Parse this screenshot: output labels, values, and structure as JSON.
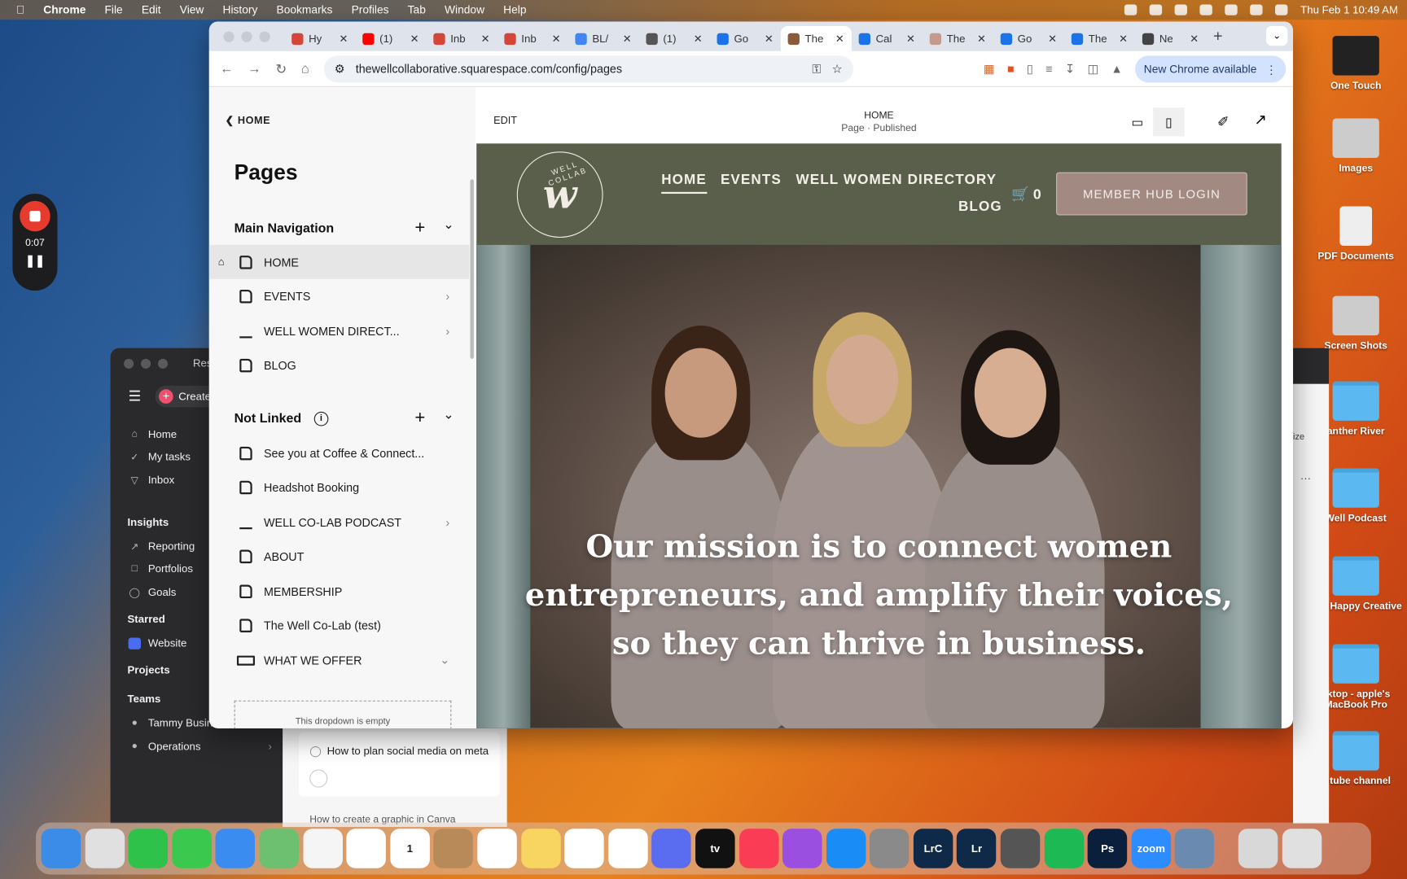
{
  "menubar": {
    "app": "Chrome",
    "items": [
      "File",
      "Edit",
      "View",
      "History",
      "Bookmarks",
      "Profiles",
      "Tab",
      "Window",
      "Help"
    ],
    "datetime": "Thu Feb 1  10:49 AM"
  },
  "recorder": {
    "time": "0:07"
  },
  "browser": {
    "tabs": [
      {
        "title": "Hy",
        "color": "#d44638"
      },
      {
        "title": "(1)",
        "color": "#ff0000"
      },
      {
        "title": "Inb",
        "color": "#d44638"
      },
      {
        "title": "Inb",
        "color": "#d44638"
      },
      {
        "title": "BL/",
        "color": "#4285f4"
      },
      {
        "title": "(1)",
        "color": "#555555"
      },
      {
        "title": "Go",
        "color": "#1a73e8"
      },
      {
        "title": "The",
        "color": "#8a5a3a",
        "active": true
      },
      {
        "title": "Cal",
        "color": "#1a73e8"
      },
      {
        "title": "The",
        "color": "#c49a8a"
      },
      {
        "title": "Go",
        "color": "#1a73e8"
      },
      {
        "title": "The",
        "color": "#1a73e8"
      },
      {
        "title": "Ne",
        "color": "#444444"
      }
    ],
    "url": "thewellcollaborative.squarespace.com/config/pages",
    "update_label": "New Chrome available"
  },
  "pages_panel": {
    "back_label": "HOME",
    "title": "Pages",
    "main_nav_label": "Main Navigation",
    "main_nav": [
      {
        "label": "HOME",
        "icon": "page",
        "home": true,
        "selected": true
      },
      {
        "label": "EVENTS",
        "icon": "calendar",
        "chevron": true
      },
      {
        "label": "WELL WOMEN DIRECT...",
        "icon": "edit",
        "chevron": true
      },
      {
        "label": "BLOG",
        "icon": "page"
      }
    ],
    "not_linked_label": "Not Linked",
    "not_linked": [
      {
        "label": "See you at Coffee & Connect...",
        "icon": "page"
      },
      {
        "label": "Headshot Booking",
        "icon": "page"
      },
      {
        "label": "WELL CO-LAB PODCAST",
        "icon": "edit",
        "chevron": true
      },
      {
        "label": "ABOUT",
        "icon": "page"
      },
      {
        "label": "MEMBERSHIP",
        "icon": "page"
      },
      {
        "label": "The Well Co-Lab (test)",
        "icon": "page"
      },
      {
        "label": "WHAT WE OFFER",
        "icon": "dropdown",
        "expand": true
      }
    ],
    "empty_dropdown": "This dropdown is empty"
  },
  "preview": {
    "edit_label": "EDIT",
    "page_title": "HOME",
    "page_status": "Page · Published",
    "site": {
      "logo_text": "WELL COLLAB",
      "logo_letter": "w",
      "nav": [
        "HOME",
        "EVENTS",
        "WELL WOMEN DIRECTORY",
        "BLOG"
      ],
      "cart_count": "0",
      "login_label": "MEMBER HUB LOGIN",
      "mission": "Our mission is to connect women entrepreneurs, and amplify their voices, so they can thrive in business.",
      "header_color": "#5a5f4c",
      "button_color": "#a28a82"
    }
  },
  "asana": {
    "title": "Res",
    "create": "Create",
    "items": [
      "Home",
      "My tasks",
      "Inbox"
    ],
    "insights": "Insights",
    "insight_items": [
      "Reporting",
      "Portfolios",
      "Goals"
    ],
    "starred": "Starred",
    "starred_items": [
      "Website"
    ],
    "projects": "Projects",
    "teams": "Teams",
    "team_items": [
      "Tammy Busin",
      "Operations"
    ],
    "task": "How to plan social media on meta",
    "task2": "How to create a graphic in Canva",
    "right_label": "ize"
  },
  "desktop": [
    {
      "label": "One Touch",
      "type": "drive"
    },
    {
      "label": "Images",
      "type": "stack"
    },
    {
      "label": "PDF Documents",
      "type": "doc"
    },
    {
      "label": "Screen Shots",
      "type": "stack"
    },
    {
      "label": "anther River",
      "type": "folder"
    },
    {
      "label": "Well Podcast",
      "type": "folder"
    },
    {
      "label": "The Happy Creative",
      "type": "folder"
    },
    {
      "label": "sktop - apple's MacBook Pro",
      "type": "folder"
    },
    {
      "label": "u tube channel",
      "type": "folder"
    }
  ],
  "dock": [
    {
      "name": "finder",
      "color": "#3b8be8"
    },
    {
      "name": "launchpad",
      "color": "#e0e0e0"
    },
    {
      "name": "facetime",
      "color": "#2fc24a"
    },
    {
      "name": "messages",
      "color": "#3ac94e"
    },
    {
      "name": "mail",
      "color": "#3a8cf0"
    },
    {
      "name": "maps",
      "color": "#6cc070"
    },
    {
      "name": "photos",
      "color": "#f5f5f5"
    },
    {
      "name": "chrome",
      "color": "#ffffff"
    },
    {
      "name": "calendar",
      "color": "#ffffff",
      "text": "1"
    },
    {
      "name": "contacts",
      "color": "#b88a5a"
    },
    {
      "name": "reminders",
      "color": "#ffffff"
    },
    {
      "name": "notes",
      "color": "#f7d560"
    },
    {
      "name": "slack",
      "color": "#ffffff"
    },
    {
      "name": "asana",
      "color": "#ffffff"
    },
    {
      "name": "perplexity",
      "color": "#5a6cf0"
    },
    {
      "name": "apple-tv",
      "color": "#111111",
      "text": "tv"
    },
    {
      "name": "music",
      "color": "#fa3c55"
    },
    {
      "name": "podcasts",
      "color": "#9b4fe0"
    },
    {
      "name": "app-store",
      "color": "#1a8cf5"
    },
    {
      "name": "system-settings",
      "color": "#8a8a8a"
    },
    {
      "name": "lightroom-classic",
      "color": "#0e2a48",
      "text": "LrC"
    },
    {
      "name": "lightroom",
      "color": "#0e2a48",
      "text": "Lr"
    },
    {
      "name": "screenshot",
      "color": "#555555"
    },
    {
      "name": "spotify",
      "color": "#1db954"
    },
    {
      "name": "photoshop",
      "color": "#0a1f3c",
      "text": "Ps"
    },
    {
      "name": "zoom",
      "color": "#2d8cff",
      "text": "zoom"
    },
    {
      "name": "preview",
      "color": "#6a8ab0"
    },
    {
      "name": "downloads",
      "color": "#d8d8d8"
    },
    {
      "name": "trash",
      "color": "#e0e0e0"
    }
  ]
}
